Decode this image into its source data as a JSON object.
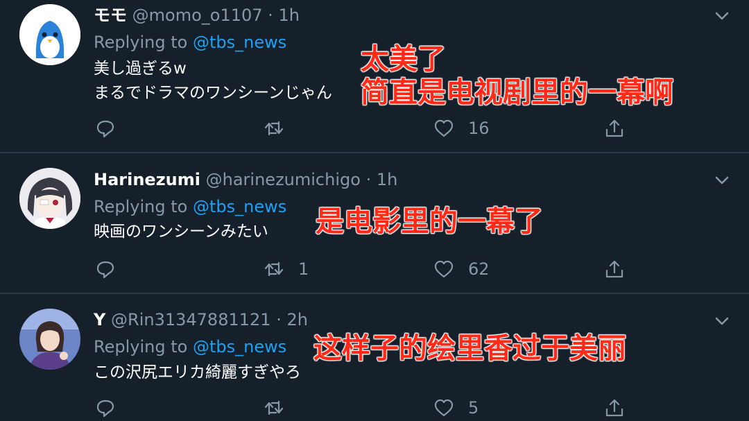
{
  "colors": {
    "background": "#15202b",
    "muted": "#8899a6",
    "mention": "#1da1f2",
    "overlay_text": "#ff2a17"
  },
  "tweets": [
    {
      "name": "モモ",
      "handle": "@momo_o1107",
      "sep": "·",
      "time": "1h",
      "replying_prefix": "Replying to",
      "mention": "@tbs_news",
      "text_lines": [
        "美し過ぎるw",
        "まるでドラマのワンシーンじゃん"
      ],
      "retweets": "",
      "likes": "16",
      "avatar_icon": "penguin-avatar-icon",
      "overlay_lines": [
        "太美了",
        "简直是电视剧里的一幕啊"
      ]
    },
    {
      "name": "Harinezumi",
      "handle": "@harinezumichigo",
      "sep": "·",
      "time": "1h",
      "replying_prefix": "Replying to",
      "mention": "@tbs_news",
      "text_lines": [
        "映画のワンシーンみたい"
      ],
      "retweets": "1",
      "likes": "62",
      "avatar_icon": "anime-girl-avatar-icon",
      "overlay_lines": [
        "是电影里的一幕了"
      ]
    },
    {
      "name": "Y",
      "handle": "@Rin31347881121",
      "sep": "·",
      "time": "2h",
      "replying_prefix": "Replying to",
      "mention": "@tbs_news",
      "text_lines": [
        "この沢尻エリカ綺麗すぎやろ"
      ],
      "retweets": "",
      "likes": "5",
      "avatar_icon": "photo-avatar-icon",
      "overlay_lines": [
        "这样子的绘里香过于美丽"
      ]
    }
  ]
}
